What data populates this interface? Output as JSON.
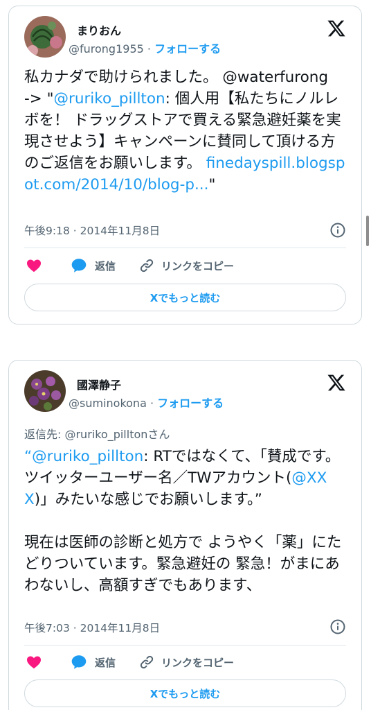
{
  "tweets": [
    {
      "author_name": "まりおん",
      "handle": "@furong1955",
      "separator": "·",
      "follow_label": "フォローする",
      "reply_to": "",
      "text": {
        "line1": "私カナダで助けられました。 @waterfurong",
        "line2a": "-> \"",
        "mention": "@ruriko_pillton",
        "line2b": ": 個人用【私たちにノルレボを！ ドラッグストアで買える緊急避妊薬を実現させよう】キャンペーンに賛同して頂ける方のご返信をお願いします。 ",
        "url": "finedayspill.blogspot.com/2014/10/blog-p...",
        "tail": "\""
      },
      "timestamp": "午後9:18 · 2014年11月8日",
      "like_icon": "heart-icon",
      "reply_label": "返信",
      "copy_label": "リンクをコピー",
      "read_more_label": "Xでもっと読む"
    },
    {
      "author_name": "國澤静子",
      "handle": "@suminokona",
      "separator": "·",
      "follow_label": "フォローする",
      "reply_to": "返信先: @ruriko_pilltonさん",
      "text": {
        "quote_open": "“",
        "mention": "@ruriko_pillton",
        "part1": ": RTではなくて、「賛成です。ツイッターユーザー名／TWアカウント(",
        "mention2": "@XXX",
        "part2": ")」みたいな感じでお願いします。”",
        "paragraph2": "現在は医師の診断と処方で ようやく「薬」にたどりついています。緊急避妊の 緊急！がまにあわないし、高額すぎでもあります、"
      },
      "timestamp": "午後7:03 · 2014年11月8日",
      "like_icon": "heart-icon",
      "reply_label": "返信",
      "copy_label": "リンクをコピー",
      "read_more_label": "Xでもっと読む"
    }
  ],
  "colors": {
    "accent": "#1d9bf0",
    "like": "#f91880",
    "muted": "#536471",
    "text": "#0f1419",
    "border": "#cfd9de"
  }
}
